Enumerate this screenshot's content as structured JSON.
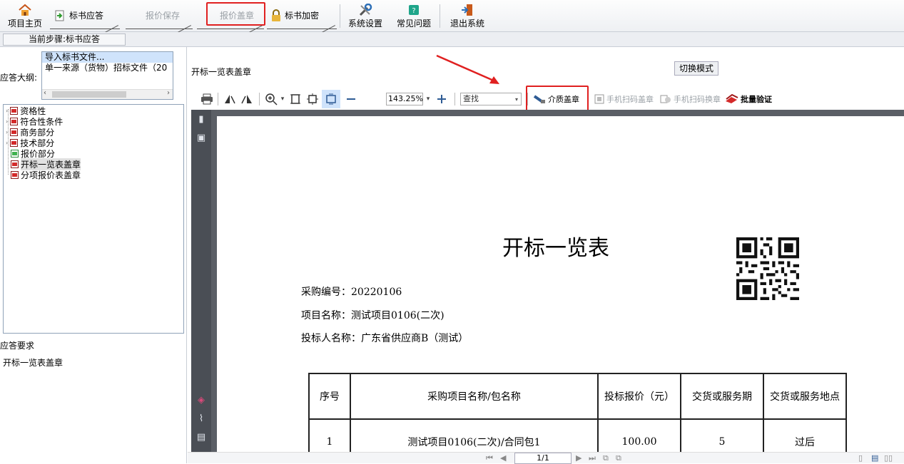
{
  "toolbar": {
    "home": "项目主页",
    "tab1": "标书应答",
    "tab2": "报价保存",
    "tab3": "报价盖章",
    "tab4": "标书加密",
    "settings": "系统设置",
    "faq": "常见问题",
    "exit": "退出系统"
  },
  "step": {
    "label": "当前步骤:标书应答"
  },
  "left": {
    "outline_label": "应答大纲:",
    "outline_items": [
      "导入标书文件...",
      "单一来源（货物）招标文件（20"
    ],
    "tree": [
      "资格性",
      "符合性条件",
      "商务部分",
      "技术部分",
      "报价部分",
      "开标一览表盖章",
      "分项报价表盖章"
    ],
    "req_title": "应答要求",
    "req_text": "开标一览表盖章"
  },
  "right": {
    "doc_label": "开标一览表盖章",
    "switch_mode": "切换模式",
    "zoom": "143.25%",
    "find_placeholder": "查找",
    "medium_seal": "介质盖章",
    "phone_seal": "手机扫码盖章",
    "phone_swap": "手机扫码换章",
    "batch_verify": "批量验证",
    "page_indicator": "1/1"
  },
  "pdf": {
    "title": "开标一览表",
    "purchase_no": "采购编号：20220106",
    "project_name": "项目名称：测试项目0106(二次)",
    "bidder": "投标人名称：广东省供应商B（测试）",
    "table": {
      "headers": [
        "序号",
        "采购项目名称/包名称",
        "投标报价（元）",
        "交货或服务期",
        "交货或服务地点"
      ],
      "row1": [
        "1",
        "测试项目0106(二次)/合同包1",
        "100.00",
        "5",
        "过后"
      ]
    }
  },
  "colors": {
    "highlight_red": "#e02020",
    "rail": "#4a4e55",
    "viewer_bg": "#5b5f66"
  }
}
